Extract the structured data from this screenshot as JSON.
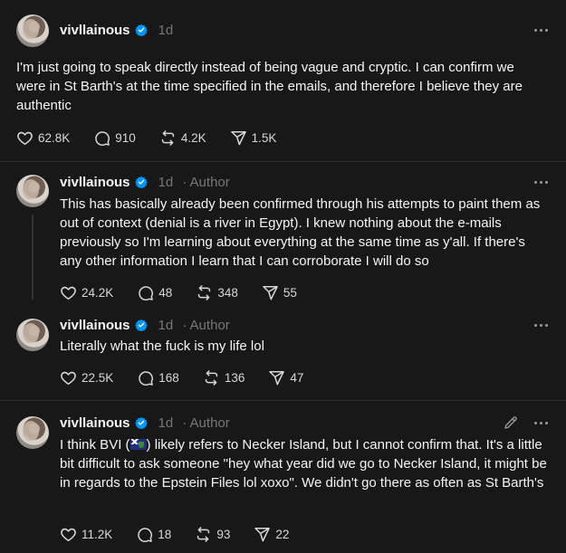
{
  "posts": [
    {
      "username": "vivllainous",
      "time": "1d",
      "author_label": "",
      "text": "I'm just going to speak directly instead of being vague and cryptic. I can confirm we were in St Barth's at the time specified in the emails, and therefore I believe they are authentic",
      "likes": "62.8K",
      "replies": "910",
      "reposts": "4.2K",
      "shares": "1.5K"
    },
    {
      "username": "vivllainous",
      "time": "1d",
      "author_label": "· Author",
      "text": "This has basically already been confirmed through his attempts to paint them as out of context (denial is a river in Egypt). I knew nothing about the e-mails previously so I'm learning about everything at the same time as y'all. If there's any other information I learn that I can corroborate I will do so",
      "likes": "24.2K",
      "replies": "48",
      "reposts": "348",
      "shares": "55"
    },
    {
      "username": "vivllainous",
      "time": "1d",
      "author_label": "· Author",
      "text": "Literally what the fuck is my life lol",
      "likes": "22.5K",
      "replies": "168",
      "reposts": "136",
      "shares": "47"
    },
    {
      "username": "vivllainous",
      "time": "1d",
      "author_label": "· Author",
      "text_before_flag": "I think BVI (",
      "text_after_flag": ") likely refers to Necker Island, but I cannot confirm that. It's a little bit difficult to ask someone \"hey what year did we go to Necker Island, it might be in regards to the Epstein Files lol xoxo\". We didn't go there as often as St Barth's",
      "likes": "11.2K",
      "replies": "18",
      "reposts": "93",
      "shares": "22"
    }
  ],
  "icons": {
    "verified": "verified-badge-icon",
    "like": "heart-icon",
    "reply": "comment-icon",
    "repost": "repost-icon",
    "share": "send-icon",
    "more": "more-icon",
    "edit": "pencil-icon"
  },
  "colors": {
    "background": "#181818",
    "text": "#f3f5f7",
    "muted": "#777777",
    "verified": "#0095f6"
  }
}
